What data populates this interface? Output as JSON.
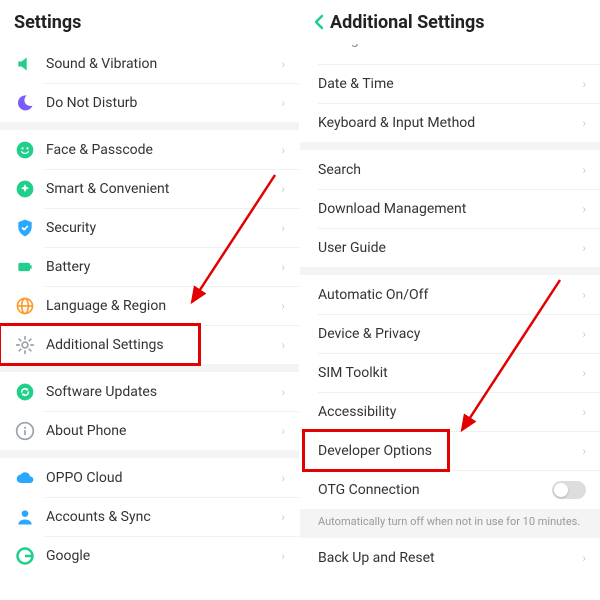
{
  "left": {
    "title": "Settings",
    "groups": [
      {
        "items": [
          {
            "key": "sound",
            "label": "Sound & Vibration",
            "icon": "speaker",
            "color": "#1fcf8a"
          },
          {
            "key": "dnd",
            "label": "Do Not Disturb",
            "icon": "moon",
            "color": "#7a5cff"
          }
        ]
      },
      {
        "items": [
          {
            "key": "face",
            "label": "Face & Passcode",
            "icon": "smile-circle",
            "color": "#1fcf8a"
          },
          {
            "key": "smart",
            "label": "Smart & Convenient",
            "icon": "spark-circle",
            "color": "#1fcf8a"
          },
          {
            "key": "security",
            "label": "Security",
            "icon": "shield",
            "color": "#2aa7ff"
          },
          {
            "key": "battery",
            "label": "Battery",
            "icon": "battery",
            "color": "#1fcf8a"
          },
          {
            "key": "lang",
            "label": "Language & Region",
            "icon": "globe",
            "color": "#ff9a2a"
          },
          {
            "key": "additional",
            "label": "Additional Settings",
            "icon": "gear",
            "color": "#9aa2ac"
          }
        ]
      },
      {
        "items": [
          {
            "key": "updates",
            "label": "Software Updates",
            "icon": "refresh-circle",
            "color": "#1fcf8a"
          },
          {
            "key": "about",
            "label": "About Phone",
            "icon": "info",
            "color": "#9aa2ac"
          }
        ]
      },
      {
        "items": [
          {
            "key": "cloud",
            "label": "OPPO Cloud",
            "icon": "cloud",
            "color": "#2aa7ff"
          },
          {
            "key": "accounts",
            "label": "Accounts & Sync",
            "icon": "user",
            "color": "#2aa7ff"
          },
          {
            "key": "google",
            "label": "Google",
            "icon": "google-g",
            "color": "#1fcf8a"
          }
        ]
      }
    ]
  },
  "right": {
    "title": "Additional Settings",
    "peek": {
      "label": "Storage"
    },
    "groups": [
      {
        "items": [
          {
            "key": "date",
            "label": "Date & Time"
          },
          {
            "key": "keyboard",
            "label": "Keyboard & Input Method"
          }
        ]
      },
      {
        "items": [
          {
            "key": "search",
            "label": "Search"
          },
          {
            "key": "download",
            "label": "Download Management"
          },
          {
            "key": "guide",
            "label": "User Guide"
          }
        ]
      },
      {
        "items": [
          {
            "key": "auto-onoff",
            "label": "Automatic On/Off"
          },
          {
            "key": "privacy",
            "label": "Device & Privacy"
          },
          {
            "key": "sim",
            "label": "SIM Toolkit"
          },
          {
            "key": "accessibility",
            "label": "Accessibility"
          },
          {
            "key": "developer",
            "label": "Developer Options"
          },
          {
            "key": "otg",
            "label": "OTG Connection",
            "toggle": true
          }
        ],
        "hint": "Automatically turn off when not in use for 10 minutes."
      },
      {
        "items": [
          {
            "key": "backup",
            "label": "Back Up and Reset"
          }
        ]
      }
    ]
  },
  "annotations": {
    "highlight_left": {
      "target": "additional"
    },
    "highlight_right": {
      "target": "developer"
    },
    "arrow_color": "#e30000"
  }
}
